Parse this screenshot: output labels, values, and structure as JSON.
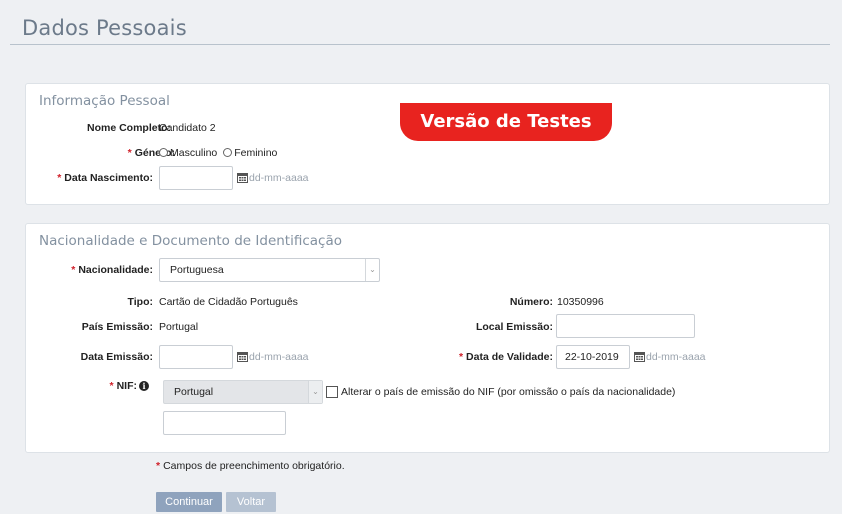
{
  "page": {
    "title": "Dados Pessoais"
  },
  "badge": {
    "text": "Versão de Testes"
  },
  "personal": {
    "section_title": "Informação Pessoal",
    "full_name_label": "Nome Completo:",
    "full_name_value": "Candidato 2",
    "gender_label": "Género:",
    "gender_options": [
      "Masculino",
      "Feminino"
    ],
    "birth_label": "Data Nascimento:",
    "birth_value": "",
    "date_hint": "dd-mm-aaaa"
  },
  "nationality": {
    "section_title": "Nacionalidade e Documento de Identificação",
    "nationality_label": "Nacionalidade:",
    "nationality_value": "Portuguesa",
    "type_label": "Tipo:",
    "type_value": "Cartão de Cidadão Português",
    "number_label": "Número:",
    "number_value": "10350996",
    "issue_country_label": "País Emissão:",
    "issue_country_value": "Portugal",
    "issue_place_label": "Local Emissão:",
    "issue_place_value": "",
    "issue_date_label": "Data Emissão:",
    "issue_date_value": "",
    "validity_label": "Data de Validade:",
    "validity_value": "22-10-2019",
    "date_hint": "dd-mm-aaaa",
    "nif_label": "NIF:",
    "nif_country_value": "Portugal",
    "nif_checkbox_label": "Alterar o país de emissão do NIF (por omissão o país da nacionalidade)",
    "nif_value": ""
  },
  "footer": {
    "required_note": "Campos de preenchimento obrigatório.",
    "continue_label": "Continuar",
    "back_label": "Voltar"
  },
  "colors": {
    "required": "#d0202a",
    "badge": "#e8231f",
    "button_primary": "#8fa3bd",
    "button_secondary": "#b5c2d2"
  }
}
